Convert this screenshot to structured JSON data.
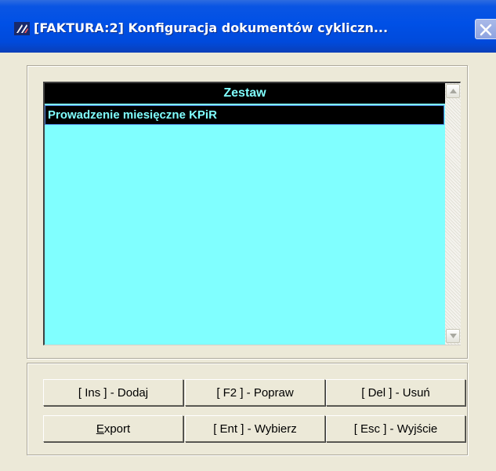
{
  "window": {
    "title": "[FAKTURA:2]  Konfiguracja dokumentów cykliczn...",
    "icon": "app-logo-icon",
    "close_icon": "close-icon"
  },
  "list": {
    "header": "Zestaw",
    "rows": [
      "Prowadzenie miesięczne KPiR"
    ],
    "selected_index": 0,
    "colors": {
      "background": "#80FFFF",
      "header_bg": "#000000",
      "selection_bg": "#000000",
      "text": "#80FFFF"
    }
  },
  "buttons": {
    "add": "[ Ins ] - Dodaj",
    "edit": "[ F2 ] - Popraw",
    "delete": "[ Del ] - Usuń",
    "export_mnemonic": "E",
    "export_rest": "xport",
    "select": "[ Ent ] - Wybierz",
    "exit": "[ Esc ] - Wyjście"
  },
  "scrollbar": {
    "up_icon": "scroll-up-arrow-icon",
    "down_icon": "scroll-down-arrow-icon"
  }
}
